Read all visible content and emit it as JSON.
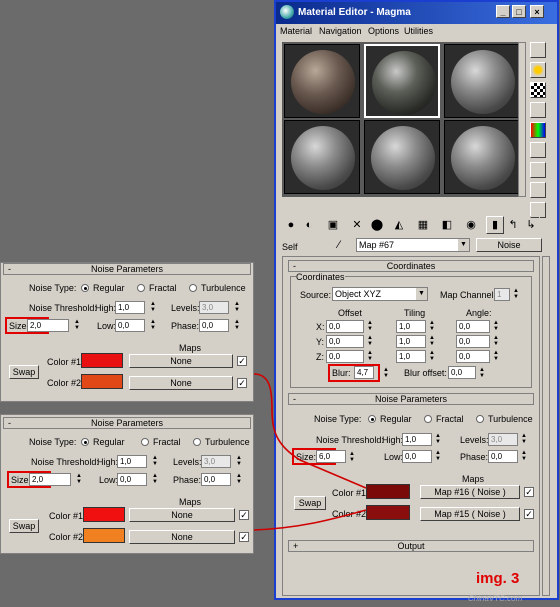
{
  "window": {
    "title": "Material Editor - Magma",
    "controls": [
      "_",
      "□",
      "×"
    ],
    "menu": [
      "Material",
      "Navigation",
      "Options",
      "Utilities"
    ],
    "self_label": "Self",
    "map_name": "Map #67",
    "map_type": "Noise"
  },
  "coordinates": {
    "header": "Coordinates",
    "group": "Coordinates",
    "source_label": "Source:",
    "source_value": "Object XYZ",
    "map_channel_label": "Map Channel:",
    "map_channel_value": "1",
    "offset_label": "Offset",
    "tiling_label": "Tiling",
    "angle_label": "Angle:",
    "axes": [
      "X:",
      "Y:",
      "Z:"
    ],
    "offset": [
      "0,0",
      "0,0",
      "0,0"
    ],
    "tiling": [
      "1,0",
      "1,0",
      "1,0"
    ],
    "angle": [
      "0,0",
      "0,0",
      "0,0"
    ],
    "blur_label": "Blur:",
    "blur_value": "4,7",
    "blur_offset_label": "Blur offset:",
    "blur_offset_value": "0,0"
  },
  "noise_main": {
    "header": "Noise Parameters",
    "noise_type_label": "Noise Type:",
    "types": [
      "Regular",
      "Fractal",
      "Turbulence"
    ],
    "threshold_label": "Noise Threshold:",
    "high_label": "High:",
    "high_value": "1,0",
    "levels_label": "Levels:",
    "levels_value": "3,0",
    "size_label": "Size:",
    "size_value": "6,0",
    "low_label": "Low:",
    "low_value": "0,0",
    "phase_label": "Phase:",
    "phase_value": "0,0",
    "maps_label": "Maps",
    "swap_label": "Swap",
    "color1_label": "Color #1",
    "color2_label": "Color #2",
    "map1": "Map #16  ( Noise )",
    "map2": "Map #15  ( Noise )",
    "color1": "#7a0a0a",
    "color2": "#8a0e0e"
  },
  "noise_left_top": {
    "sign": "-",
    "header": "Noise Parameters",
    "noise_type_label": "Noise Type:",
    "types": [
      "Regular",
      "Fractal",
      "Turbulence"
    ],
    "threshold_label": "Noise Threshold:",
    "high_label": "High:",
    "high_value": "1,0",
    "levels_label": "Levels:",
    "levels_value": "3,0",
    "size_label": "Size:",
    "size_value": "2,0",
    "low_label": "Low:",
    "low_value": "0,0",
    "phase_label": "Phase:",
    "phase_value": "0,0",
    "maps_label": "Maps",
    "swap_label": "Swap",
    "color1_label": "Color #1",
    "color2_label": "Color #2",
    "map_none": "None",
    "color1": "#e81010",
    "color2": "#e04818"
  },
  "noise_left_bottom": {
    "sign": "-",
    "header": "Noise Parameters",
    "noise_type_label": "Noise Type:",
    "types": [
      "Regular",
      "Fractal",
      "Turbulence"
    ],
    "threshold_label": "Noise Threshold:",
    "high_label": "High:",
    "high_value": "1,0",
    "levels_label": "Levels:",
    "levels_value": "3,0",
    "size_label": "Size:",
    "size_value": "2,0",
    "low_label": "Low:",
    "low_value": "0,0",
    "phase_label": "Phase:",
    "phase_value": "0,0",
    "maps_label": "Maps",
    "swap_label": "Swap",
    "color1_label": "Color #1",
    "color2_label": "Color #2",
    "map_none": "None",
    "color1": "#f01010",
    "color2": "#f08020"
  },
  "output_header": "Output",
  "caption": "img. 3",
  "watermark": "ChinaVTC.com"
}
